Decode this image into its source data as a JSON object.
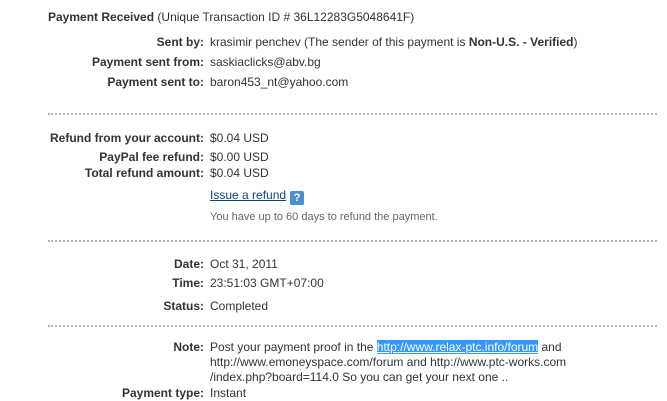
{
  "header": {
    "title": "Payment Received",
    "transaction": "(Unique Transaction ID # 36L12283G5048641F)"
  },
  "sender": {
    "sent_by_label": "Sent by:",
    "sent_by_name": "krasimir penchev",
    "sender_note_pre": "(The sender of this payment is",
    "sender_status": "Non-U.S. - Verified",
    "sender_note_post": ")",
    "sent_from_label": "Payment sent from:",
    "sent_from_value": "saskiaclicks@abv.bg",
    "sent_to_label": "Payment sent to:",
    "sent_to_value": "baron453_nt@yahoo.com"
  },
  "refund": {
    "from_account_label": "Refund from your account:",
    "from_account_value": "$0.04 USD",
    "fee_label": "PayPal fee refund:",
    "fee_value": "$0.00 USD",
    "total_label": "Total refund amount:",
    "total_value": "$0.04 USD",
    "issue_link": "Issue a refund",
    "help_icon_glyph": "?",
    "note": "You have up to 60 days to refund the payment."
  },
  "details": {
    "date_label": "Date:",
    "date_value": "Oct 31, 2011",
    "time_label": "Time:",
    "time_value": "23:51:03 GMT+07:00",
    "status_label": "Status:",
    "status_value": "Completed"
  },
  "note": {
    "label": "Note:",
    "line1_pre": "Post your payment proof in the ",
    "line1_link": "http://www.relax-ptc.info/forum",
    "line1_post": " and",
    "line2": "http://www.emoneyspace.com/forum and http://www.ptc-works.com",
    "line3": "/index.php?board=114.0 So you can get your next one .."
  },
  "payment_type": {
    "label": "Payment type:",
    "value": "Instant"
  }
}
